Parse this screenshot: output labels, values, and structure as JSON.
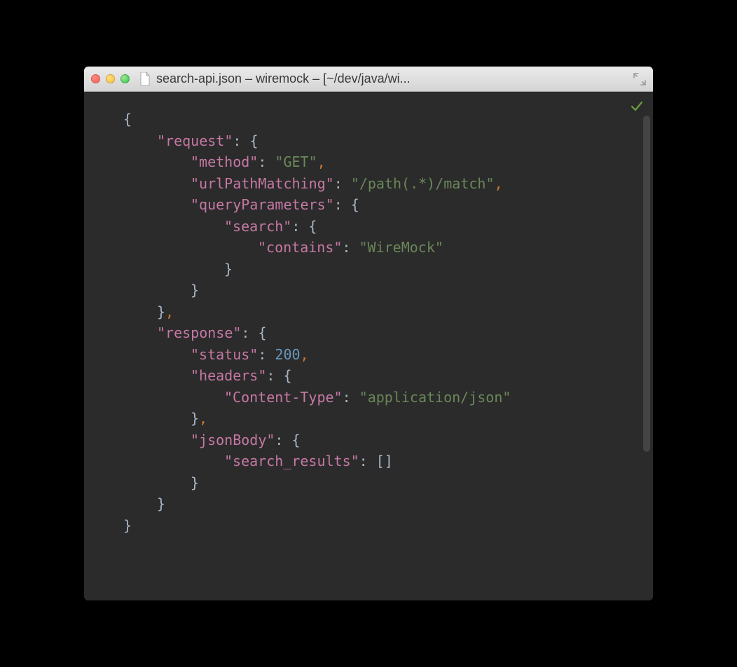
{
  "window": {
    "title": "search-api.json – wiremock – [~/dev/java/wi..."
  },
  "code": {
    "keys": {
      "request": "\"request\"",
      "method": "\"method\"",
      "urlPathMatching": "\"urlPathMatching\"",
      "queryParameters": "\"queryParameters\"",
      "search": "\"search\"",
      "contains": "\"contains\"",
      "response": "\"response\"",
      "status": "\"status\"",
      "headers": "\"headers\"",
      "contentType": "\"Content-Type\"",
      "jsonBody": "\"jsonBody\"",
      "searchResults": "\"search_results\""
    },
    "values": {
      "method": "\"GET\"",
      "urlPathMatching": "\"/path(.*)/match\"",
      "contains": "\"WireMock\"",
      "status": "200",
      "contentType": "\"application/json\"",
      "searchResults": "[]"
    },
    "punct": {
      "openBrace": "{",
      "closeBrace": "}",
      "colon": ":",
      "space": " ",
      "comma": ","
    }
  }
}
